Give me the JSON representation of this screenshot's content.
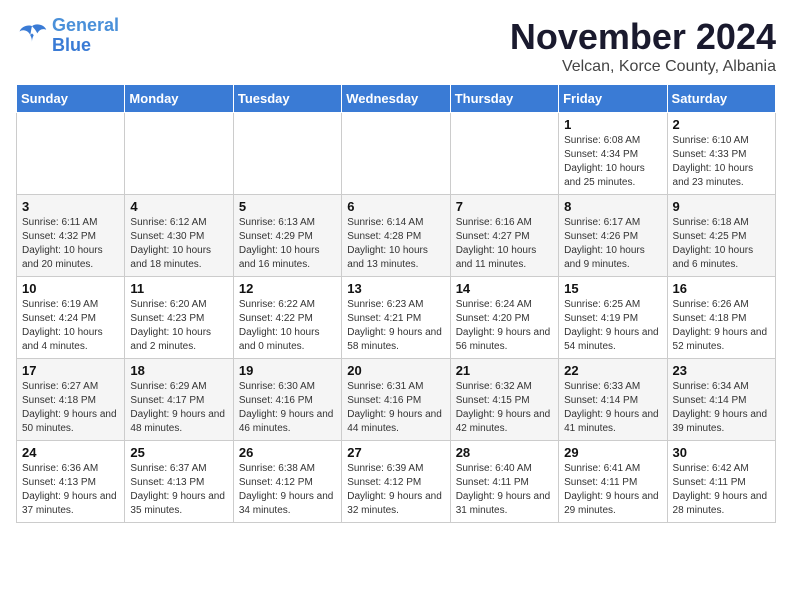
{
  "logo": {
    "line1": "General",
    "line2": "Blue"
  },
  "title": "November 2024",
  "location": "Velcan, Korce County, Albania",
  "weekdays": [
    "Sunday",
    "Monday",
    "Tuesday",
    "Wednesday",
    "Thursday",
    "Friday",
    "Saturday"
  ],
  "weeks": [
    [
      {
        "day": "",
        "info": ""
      },
      {
        "day": "",
        "info": ""
      },
      {
        "day": "",
        "info": ""
      },
      {
        "day": "",
        "info": ""
      },
      {
        "day": "",
        "info": ""
      },
      {
        "day": "1",
        "info": "Sunrise: 6:08 AM\nSunset: 4:34 PM\nDaylight: 10 hours and 25 minutes."
      },
      {
        "day": "2",
        "info": "Sunrise: 6:10 AM\nSunset: 4:33 PM\nDaylight: 10 hours and 23 minutes."
      }
    ],
    [
      {
        "day": "3",
        "info": "Sunrise: 6:11 AM\nSunset: 4:32 PM\nDaylight: 10 hours and 20 minutes."
      },
      {
        "day": "4",
        "info": "Sunrise: 6:12 AM\nSunset: 4:30 PM\nDaylight: 10 hours and 18 minutes."
      },
      {
        "day": "5",
        "info": "Sunrise: 6:13 AM\nSunset: 4:29 PM\nDaylight: 10 hours and 16 minutes."
      },
      {
        "day": "6",
        "info": "Sunrise: 6:14 AM\nSunset: 4:28 PM\nDaylight: 10 hours and 13 minutes."
      },
      {
        "day": "7",
        "info": "Sunrise: 6:16 AM\nSunset: 4:27 PM\nDaylight: 10 hours and 11 minutes."
      },
      {
        "day": "8",
        "info": "Sunrise: 6:17 AM\nSunset: 4:26 PM\nDaylight: 10 hours and 9 minutes."
      },
      {
        "day": "9",
        "info": "Sunrise: 6:18 AM\nSunset: 4:25 PM\nDaylight: 10 hours and 6 minutes."
      }
    ],
    [
      {
        "day": "10",
        "info": "Sunrise: 6:19 AM\nSunset: 4:24 PM\nDaylight: 10 hours and 4 minutes."
      },
      {
        "day": "11",
        "info": "Sunrise: 6:20 AM\nSunset: 4:23 PM\nDaylight: 10 hours and 2 minutes."
      },
      {
        "day": "12",
        "info": "Sunrise: 6:22 AM\nSunset: 4:22 PM\nDaylight: 10 hours and 0 minutes."
      },
      {
        "day": "13",
        "info": "Sunrise: 6:23 AM\nSunset: 4:21 PM\nDaylight: 9 hours and 58 minutes."
      },
      {
        "day": "14",
        "info": "Sunrise: 6:24 AM\nSunset: 4:20 PM\nDaylight: 9 hours and 56 minutes."
      },
      {
        "day": "15",
        "info": "Sunrise: 6:25 AM\nSunset: 4:19 PM\nDaylight: 9 hours and 54 minutes."
      },
      {
        "day": "16",
        "info": "Sunrise: 6:26 AM\nSunset: 4:18 PM\nDaylight: 9 hours and 52 minutes."
      }
    ],
    [
      {
        "day": "17",
        "info": "Sunrise: 6:27 AM\nSunset: 4:18 PM\nDaylight: 9 hours and 50 minutes."
      },
      {
        "day": "18",
        "info": "Sunrise: 6:29 AM\nSunset: 4:17 PM\nDaylight: 9 hours and 48 minutes."
      },
      {
        "day": "19",
        "info": "Sunrise: 6:30 AM\nSunset: 4:16 PM\nDaylight: 9 hours and 46 minutes."
      },
      {
        "day": "20",
        "info": "Sunrise: 6:31 AM\nSunset: 4:16 PM\nDaylight: 9 hours and 44 minutes."
      },
      {
        "day": "21",
        "info": "Sunrise: 6:32 AM\nSunset: 4:15 PM\nDaylight: 9 hours and 42 minutes."
      },
      {
        "day": "22",
        "info": "Sunrise: 6:33 AM\nSunset: 4:14 PM\nDaylight: 9 hours and 41 minutes."
      },
      {
        "day": "23",
        "info": "Sunrise: 6:34 AM\nSunset: 4:14 PM\nDaylight: 9 hours and 39 minutes."
      }
    ],
    [
      {
        "day": "24",
        "info": "Sunrise: 6:36 AM\nSunset: 4:13 PM\nDaylight: 9 hours and 37 minutes."
      },
      {
        "day": "25",
        "info": "Sunrise: 6:37 AM\nSunset: 4:13 PM\nDaylight: 9 hours and 35 minutes."
      },
      {
        "day": "26",
        "info": "Sunrise: 6:38 AM\nSunset: 4:12 PM\nDaylight: 9 hours and 34 minutes."
      },
      {
        "day": "27",
        "info": "Sunrise: 6:39 AM\nSunset: 4:12 PM\nDaylight: 9 hours and 32 minutes."
      },
      {
        "day": "28",
        "info": "Sunrise: 6:40 AM\nSunset: 4:11 PM\nDaylight: 9 hours and 31 minutes."
      },
      {
        "day": "29",
        "info": "Sunrise: 6:41 AM\nSunset: 4:11 PM\nDaylight: 9 hours and 29 minutes."
      },
      {
        "day": "30",
        "info": "Sunrise: 6:42 AM\nSunset: 4:11 PM\nDaylight: 9 hours and 28 minutes."
      }
    ]
  ]
}
